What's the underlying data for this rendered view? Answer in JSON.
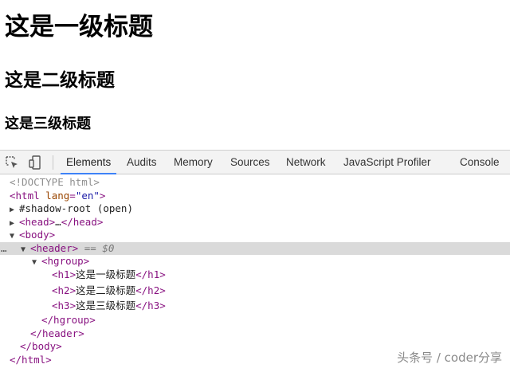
{
  "page": {
    "h1": "这是一级标题",
    "h2": "这是二级标题",
    "h3": "这是三级标题"
  },
  "devtools": {
    "tabs": [
      {
        "label": "Elements",
        "active": true
      },
      {
        "label": "Audits"
      },
      {
        "label": "Memory"
      },
      {
        "label": "Sources"
      },
      {
        "label": "Network"
      },
      {
        "label": "JavaScript Profiler"
      },
      {
        "label": "Console"
      }
    ],
    "tree": {
      "doctype": "<!DOCTYPE html>",
      "html_open_tag": "<html",
      "html_attr_name": " lang",
      "html_attr_eq": "=",
      "html_attr_value": "\"en\"",
      "html_open_end": ">",
      "shadow_root": "#shadow-root (open)",
      "head_open": "<head>",
      "head_ellipsis": "…",
      "head_close": "</head>",
      "body_open": "<body>",
      "header_open": "<header>",
      "selected_marker": " == $0",
      "ellipsis_marker": "…",
      "hgroup_open": "<hgroup>",
      "h1_open": "<h1>",
      "h1_text": "这是一级标题",
      "h1_close": "</h1>",
      "h2_open": "<h2>",
      "h2_text": "这是二级标题",
      "h2_close": "</h2>",
      "h3_open": "<h3>",
      "h3_text": "这是三级标题",
      "h3_close": "</h3>",
      "hgroup_close": "</hgroup>",
      "header_close": "</header>",
      "body_close": "</body>",
      "html_close": "</html>"
    }
  },
  "watermark": "头条号 / coder分享",
  "colors": {
    "tag": "#881280",
    "attr_name": "#994500",
    "attr_value": "#1a1aa6",
    "active_tab_underline": "#3e82f7",
    "selected_row": "#dadada"
  },
  "icons": [
    "inspect-element-icon",
    "device-toolbar-icon"
  ]
}
